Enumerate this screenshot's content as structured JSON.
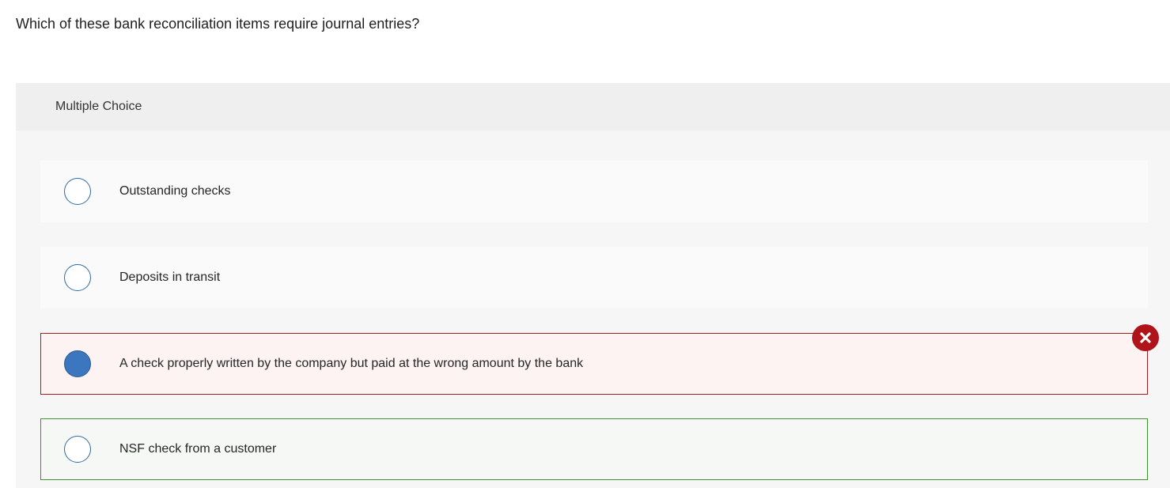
{
  "question": {
    "text": "Which of these bank reconciliation items require journal entries?"
  },
  "panel": {
    "header_label": "Multiple Choice"
  },
  "options": [
    {
      "label": "Outstanding checks",
      "selected": false,
      "status": "none"
    },
    {
      "label": "Deposits in transit",
      "selected": false,
      "status": "none"
    },
    {
      "label": "A check properly written by the company but paid at the wrong amount by the bank",
      "selected": true,
      "status": "incorrect"
    },
    {
      "label": "NSF check from a customer",
      "selected": false,
      "status": "correct"
    }
  ],
  "feedback": {
    "incorrect_icon": "close-icon"
  },
  "colors": {
    "selected_radio": "#3b76be",
    "incorrect_border": "#a32020",
    "correct_border": "#3f8f34",
    "incorrect_badge": "#b0141b"
  }
}
